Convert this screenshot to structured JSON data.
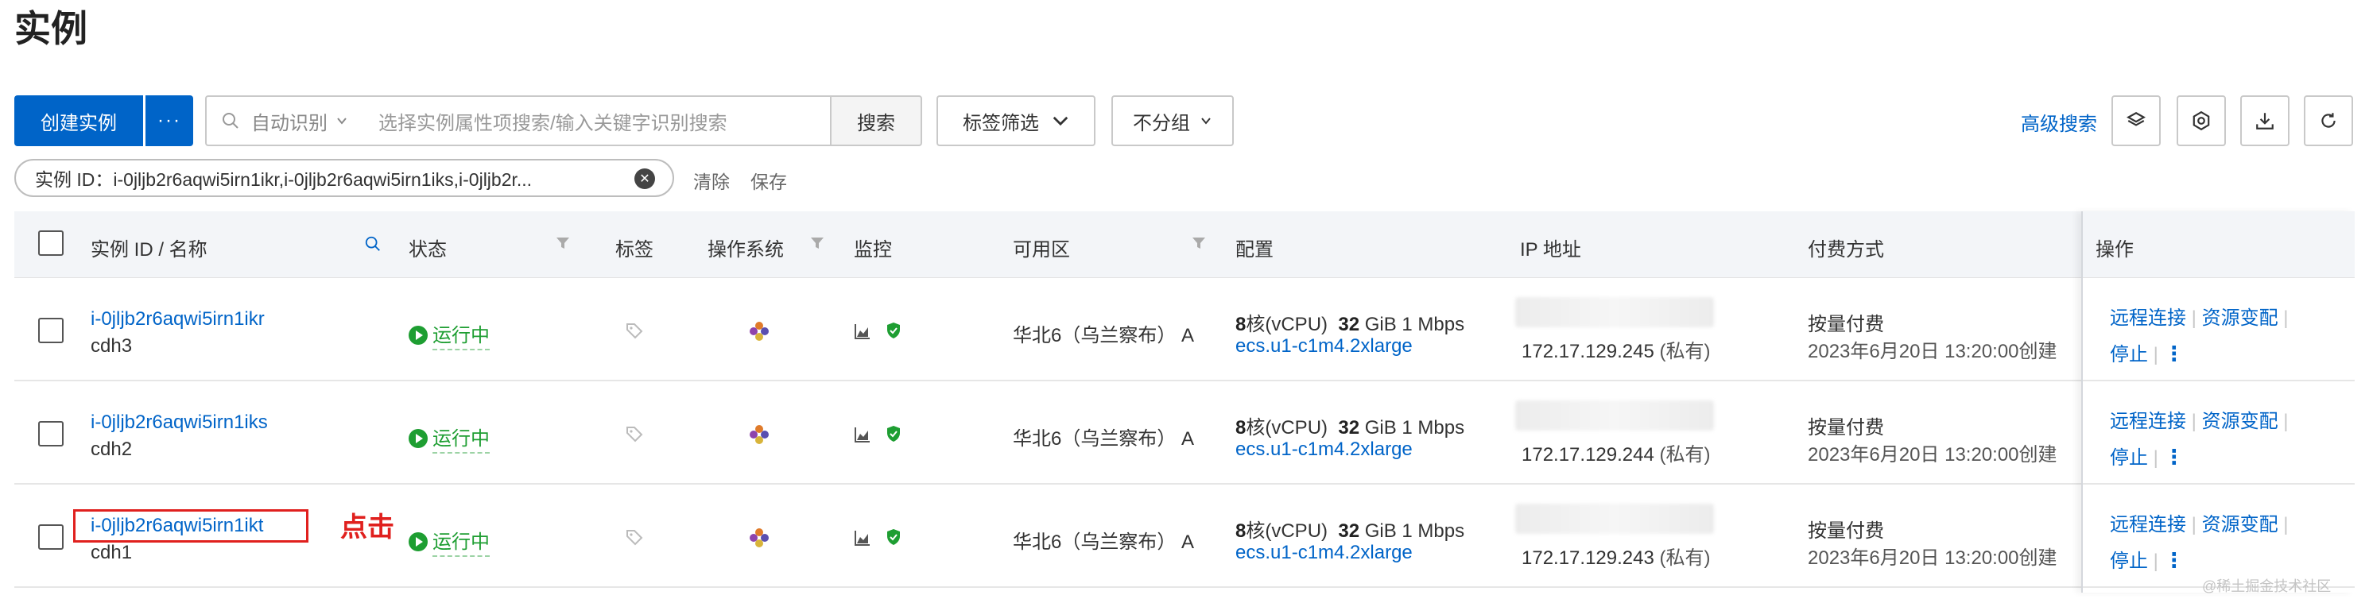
{
  "page": {
    "title": "实例"
  },
  "toolbar": {
    "create_label": "创建实例",
    "more_label": "···",
    "search_mode": "自动识别",
    "search_placeholder": "选择实例属性项搜索/输入关键字识别搜索",
    "search_button": "搜索",
    "tag_filter": "标签筛选",
    "group_select": "不分组",
    "advanced_search": "高级搜索"
  },
  "filter": {
    "chip_label": "实例 ID：i-0jljb2r6aqwi5irn1ikr,i-0jljb2r6aqwi5irn1iks,i-0jljb2r...",
    "clear": "清除",
    "save": "保存"
  },
  "table": {
    "headers": {
      "instance": "实例 ID / 名称",
      "status": "状态",
      "tags": "标签",
      "os": "操作系统",
      "monitor": "监控",
      "zone": "可用区",
      "config": "配置",
      "ip": "IP 地址",
      "billing": "付费方式",
      "ops": "操作"
    },
    "rows": [
      {
        "id": "i-0jljb2r6aqwi5irn1ikr",
        "name": "cdh3",
        "status": "运行中",
        "zone": "华北6（乌兰察布） A",
        "cpu_num": "8",
        "cpu_unit": "核(vCPU)",
        "mem_num": "32",
        "mem_rest": "GiB 1 Mbps",
        "instance_type": "ecs.u1-c1m4.2xlarge",
        "ip": "172.17.129.245",
        "ip_note": "(私有)",
        "billing": "按量付费",
        "created": "2023年6月20日 13:20:00创建"
      },
      {
        "id": "i-0jljb2r6aqwi5irn1iks",
        "name": "cdh2",
        "status": "运行中",
        "zone": "华北6（乌兰察布） A",
        "cpu_num": "8",
        "cpu_unit": "核(vCPU)",
        "mem_num": "32",
        "mem_rest": "GiB 1 Mbps",
        "instance_type": "ecs.u1-c1m4.2xlarge",
        "ip": "172.17.129.244",
        "ip_note": "(私有)",
        "billing": "按量付费",
        "created": "2023年6月20日 13:20:00创建"
      },
      {
        "id": "i-0jljb2r6aqwi5irn1ikt",
        "name": "cdh1",
        "status": "运行中",
        "zone": "华北6（乌兰察布） A",
        "cpu_num": "8",
        "cpu_unit": "核(vCPU)",
        "mem_num": "32",
        "mem_rest": "GiB 1 Mbps",
        "instance_type": "ecs.u1-c1m4.2xlarge",
        "ip": "172.17.129.243",
        "ip_note": "(私有)",
        "billing": "按量付费",
        "created": "2023年6月20日 13:20:00创建"
      }
    ],
    "ops": {
      "remote": "远程连接",
      "resize": "资源变配",
      "stop": "停止",
      "more": "⋮"
    }
  },
  "annotation": {
    "click_label": "点击"
  },
  "watermark": "@稀土掘金技术社区",
  "colors": {
    "primary": "#0064c8",
    "running": "#1e9e32",
    "annotation": "#e0201e"
  }
}
